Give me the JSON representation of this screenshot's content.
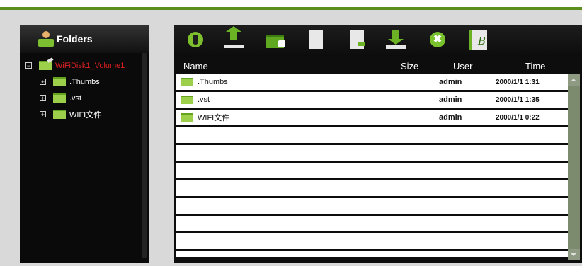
{
  "sidebar": {
    "title": "Folders",
    "root": {
      "label": "WiFiDisk1_Volume1",
      "expander": "−"
    },
    "children": [
      {
        "label": ".Thumbs",
        "expander": "+"
      },
      {
        "label": ".vst",
        "expander": "+"
      },
      {
        "label": "WIFI文件",
        "expander": "+"
      }
    ]
  },
  "toolbar": {
    "icons": [
      "refresh-icon",
      "upload-icon",
      "new-folder-icon",
      "copy-icon",
      "paste-icon",
      "download-icon",
      "delete-icon",
      "rename-icon"
    ],
    "rename_glyph": "B"
  },
  "table": {
    "columns": {
      "name": "Name",
      "size": "Size",
      "user": "User",
      "time": "Time"
    },
    "rows": [
      {
        "name": ".Thumbs",
        "size": "",
        "user": "admin",
        "time": "2000/1/1 1:31"
      },
      {
        "name": ".vst",
        "size": "",
        "user": "admin",
        "time": "2000/1/1 1:35"
      },
      {
        "name": "WIFI文件",
        "size": "",
        "user": "admin",
        "time": "2000/1/1 0:22"
      }
    ]
  },
  "colors": {
    "accent": "#5a8f1e",
    "root_text": "#e02020",
    "folder": "#9cd04a"
  }
}
